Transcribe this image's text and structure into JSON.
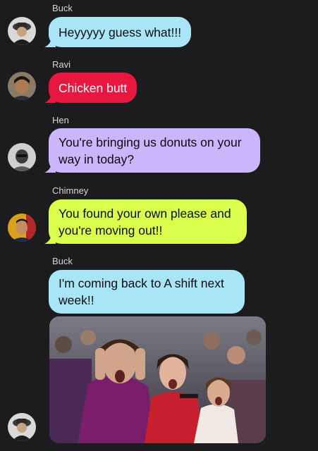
{
  "colors": {
    "background": "#1c1c1e",
    "bubble_buck": "#a8e6f7",
    "bubble_ravi": "#e8173f",
    "bubble_hen": "#cbb5fb",
    "bubble_chimney": "#d9ff4c"
  },
  "messages": [
    {
      "sender": "Buck",
      "text": "Heyyyyy guess what!!!",
      "avatar_icon": "firefighter-avatar-icon"
    },
    {
      "sender": "Ravi",
      "text": "Chicken butt",
      "avatar_icon": "person-avatar-icon"
    },
    {
      "sender": "Hen",
      "text": "You're bringing us donuts on your way in today?",
      "avatar_icon": "person-avatar-icon"
    },
    {
      "sender": "Chimney",
      "text": "You found your own please and you're moving out!!",
      "avatar_icon": "person-avatar-icon"
    },
    {
      "sender": "Buck",
      "text": "I'm coming back to A shift next week!!",
      "avatar_icon": "firefighter-avatar-icon",
      "attachment": "cheering-crowd-gif"
    }
  ]
}
